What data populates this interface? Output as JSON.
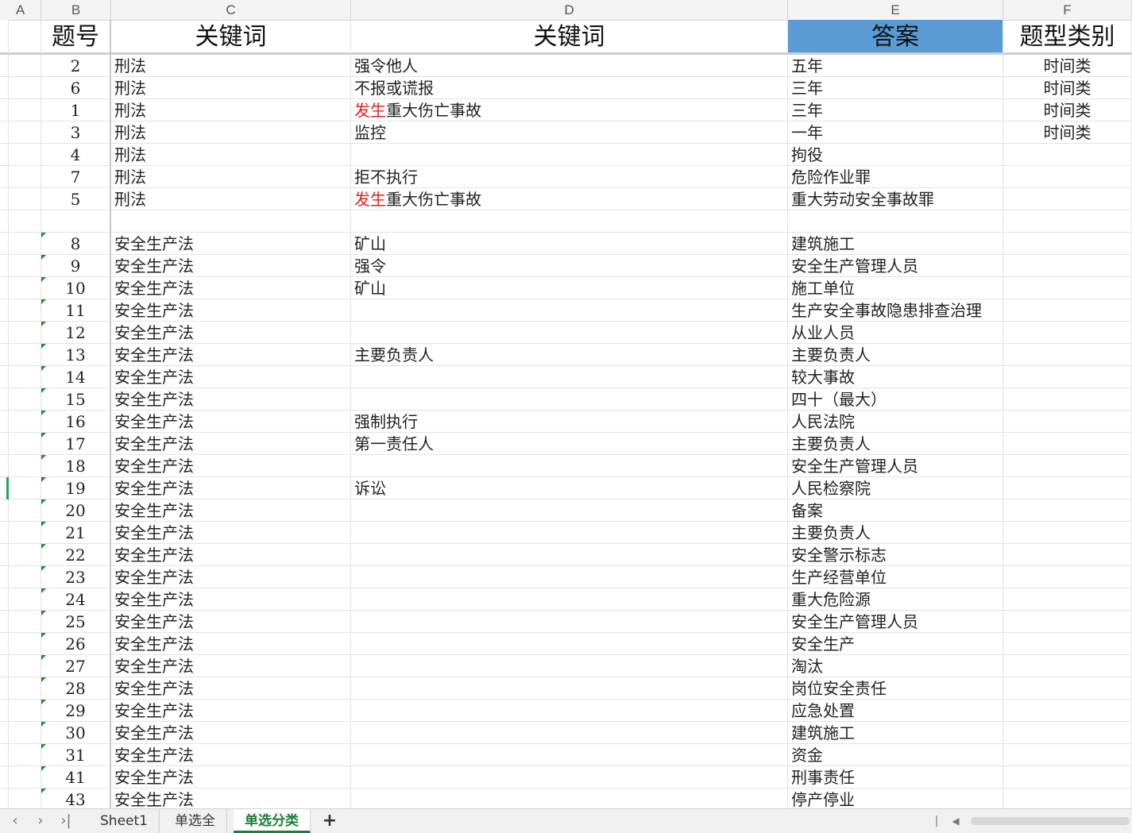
{
  "columns": [
    "A",
    "B",
    "C",
    "D",
    "E",
    "F"
  ],
  "header": {
    "b": "题号",
    "c": "关键词",
    "d": "关键词",
    "e": "答案",
    "f": "题型类别"
  },
  "rows": [
    {
      "num": "2",
      "c": "刑法",
      "d": "强令他人",
      "d_red": "",
      "e": "五年",
      "f": "时间类",
      "mark": false
    },
    {
      "num": "6",
      "c": "刑法",
      "d": "不报或谎报",
      "d_red": "",
      "e": "三年",
      "f": "时间类",
      "mark": false
    },
    {
      "num": "1",
      "c": "刑法",
      "d": "重大伤亡事故",
      "d_red": "发生",
      "e": "三年",
      "f": "时间类",
      "mark": false
    },
    {
      "num": "3",
      "c": "刑法",
      "d": "监控",
      "d_red": "",
      "e": "一年",
      "f": "时间类",
      "mark": false
    },
    {
      "num": "4",
      "c": "刑法",
      "d": "",
      "d_red": "",
      "e": "拘役",
      "f": "",
      "mark": false
    },
    {
      "num": "7",
      "c": "刑法",
      "d": "拒不执行",
      "d_red": "",
      "e": "危险作业罪",
      "f": "",
      "mark": false
    },
    {
      "num": "5",
      "c": "刑法",
      "d": "重大伤亡事故",
      "d_red": "发生",
      "e": "重大劳动安全事故罪",
      "f": "",
      "mark": false
    },
    {
      "num": "",
      "c": "",
      "d": "",
      "d_red": "",
      "e": "",
      "f": "",
      "mark": false
    },
    {
      "num": "8",
      "c": "安全生产法",
      "d": "矿山",
      "d_red": "",
      "e": "建筑施工",
      "f": "",
      "mark": true
    },
    {
      "num": "9",
      "c": "安全生产法",
      "d": "强令",
      "d_red": "",
      "e": "安全生产管理人员",
      "f": "",
      "mark": true
    },
    {
      "num": "10",
      "c": "安全生产法",
      "d": "矿山",
      "d_red": "",
      "e": "施工单位",
      "f": "",
      "mark": true
    },
    {
      "num": "11",
      "c": "安全生产法",
      "d": "",
      "d_red": "",
      "e": "生产安全事故隐患排查治理",
      "f": "",
      "mark": true
    },
    {
      "num": "12",
      "c": "安全生产法",
      "d": "",
      "d_red": "",
      "e": "从业人员",
      "f": "",
      "mark": true
    },
    {
      "num": "13",
      "c": "安全生产法",
      "d": "主要负责人",
      "d_red": "",
      "e": "主要负责人",
      "f": "",
      "mark": true
    },
    {
      "num": "14",
      "c": "安全生产法",
      "d": "",
      "d_red": "",
      "e": "较大事故",
      "f": "",
      "mark": true
    },
    {
      "num": "15",
      "c": "安全生产法",
      "d": "",
      "d_red": "",
      "e": "四十（最大）",
      "f": "",
      "mark": true
    },
    {
      "num": "16",
      "c": "安全生产法",
      "d": "强制执行",
      "d_red": "",
      "e": "人民法院",
      "f": "",
      "mark": true
    },
    {
      "num": "17",
      "c": "安全生产法",
      "d": "第一责任人",
      "d_red": "",
      "e": "主要负责人",
      "f": "",
      "mark": true
    },
    {
      "num": "18",
      "c": "安全生产法",
      "d": "",
      "d_red": "",
      "e": "安全生产管理人员",
      "f": "",
      "mark": true
    },
    {
      "num": "19",
      "c": "安全生产法",
      "d": "诉讼",
      "d_red": "",
      "e": "人民检察院",
      "f": "",
      "mark": true
    },
    {
      "num": "20",
      "c": "安全生产法",
      "d": "",
      "d_red": "",
      "e": "备案",
      "f": "",
      "mark": true
    },
    {
      "num": "21",
      "c": "安全生产法",
      "d": "",
      "d_red": "",
      "e": "主要负责人",
      "f": "",
      "mark": true
    },
    {
      "num": "22",
      "c": "安全生产法",
      "d": "",
      "d_red": "",
      "e": "安全警示标志",
      "f": "",
      "mark": true
    },
    {
      "num": "23",
      "c": "安全生产法",
      "d": "",
      "d_red": "",
      "e": "生产经营单位",
      "f": "",
      "mark": true
    },
    {
      "num": "24",
      "c": "安全生产法",
      "d": "",
      "d_red": "",
      "e": "重大危险源",
      "f": "",
      "mark": true
    },
    {
      "num": "25",
      "c": "安全生产法",
      "d": "",
      "d_red": "",
      "e": "安全生产管理人员",
      "f": "",
      "mark": true
    },
    {
      "num": "26",
      "c": "安全生产法",
      "d": "",
      "d_red": "",
      "e": "安全生产",
      "f": "",
      "mark": true
    },
    {
      "num": "27",
      "c": "安全生产法",
      "d": "",
      "d_red": "",
      "e": "淘汰",
      "f": "",
      "mark": true
    },
    {
      "num": "28",
      "c": "安全生产法",
      "d": "",
      "d_red": "",
      "e": "岗位安全责任",
      "f": "",
      "mark": true
    },
    {
      "num": "29",
      "c": "安全生产法",
      "d": "",
      "d_red": "",
      "e": "应急处置",
      "f": "",
      "mark": true
    },
    {
      "num": "30",
      "c": "安全生产法",
      "d": "",
      "d_red": "",
      "e": "建筑施工",
      "f": "",
      "mark": true
    },
    {
      "num": "31",
      "c": "安全生产法",
      "d": "",
      "d_red": "",
      "e": "资金",
      "f": "",
      "mark": true
    },
    {
      "num": "41",
      "c": "安全生产法",
      "d": "",
      "d_red": "",
      "e": "刑事责任",
      "f": "",
      "mark": true
    },
    {
      "num": "43",
      "c": "安全生产法",
      "d": "",
      "d_red": "",
      "e": "停产停业",
      "f": "",
      "mark": true
    }
  ],
  "tabs": [
    {
      "label": "Sheet1",
      "active": false
    },
    {
      "label": "单选全",
      "active": false
    },
    {
      "label": "单选分类",
      "active": true
    }
  ],
  "tabbar": {
    "first_icon": "chevron-left-icon",
    "next_icon": "chevron-right-icon",
    "last_icon": "last-sheet-icon",
    "add_label": "+"
  },
  "colors": {
    "header_highlight": "#5b9bd5",
    "active_tab": "#1a7f37",
    "red_text": "#e02020"
  }
}
